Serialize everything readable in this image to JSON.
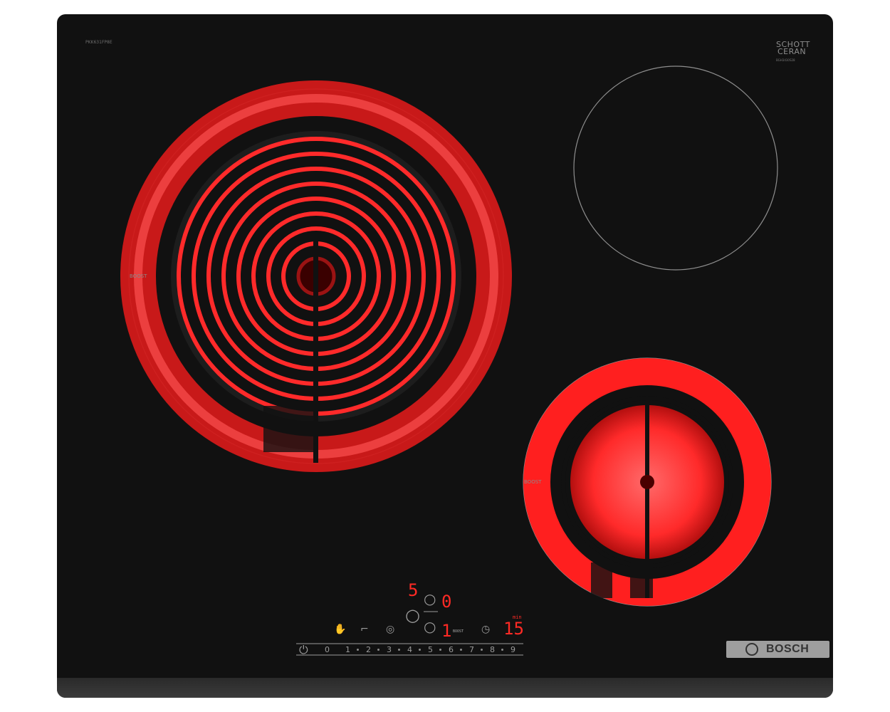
{
  "product": {
    "model_code": "PKK631FP8E",
    "glass_brand_line1": "SCHOTT",
    "glass_brand_line2": "CERAN",
    "glass_code": "BGH3430S28",
    "boost_left": "BOOST",
    "boost_right": "BOOST",
    "brand": "BOSCH"
  },
  "controls": {
    "display_top": "5",
    "display_top2": "0",
    "display_bottom": "1",
    "timer_label": "min",
    "timer_value": "15",
    "boost_small": "BOOST",
    "scale": [
      "0",
      "1",
      "2",
      "3",
      "4",
      "5",
      "6",
      "7",
      "8",
      "9"
    ]
  },
  "icons": {
    "power": "power-icon",
    "childlock": "hand-icon",
    "key": "key-icon",
    "ring": "dual-ring-icon",
    "timer": "clock-icon"
  },
  "colors": {
    "hob_black": "#111111",
    "heat_red": "#ff1f1f",
    "display_red": "#ff2a25"
  }
}
